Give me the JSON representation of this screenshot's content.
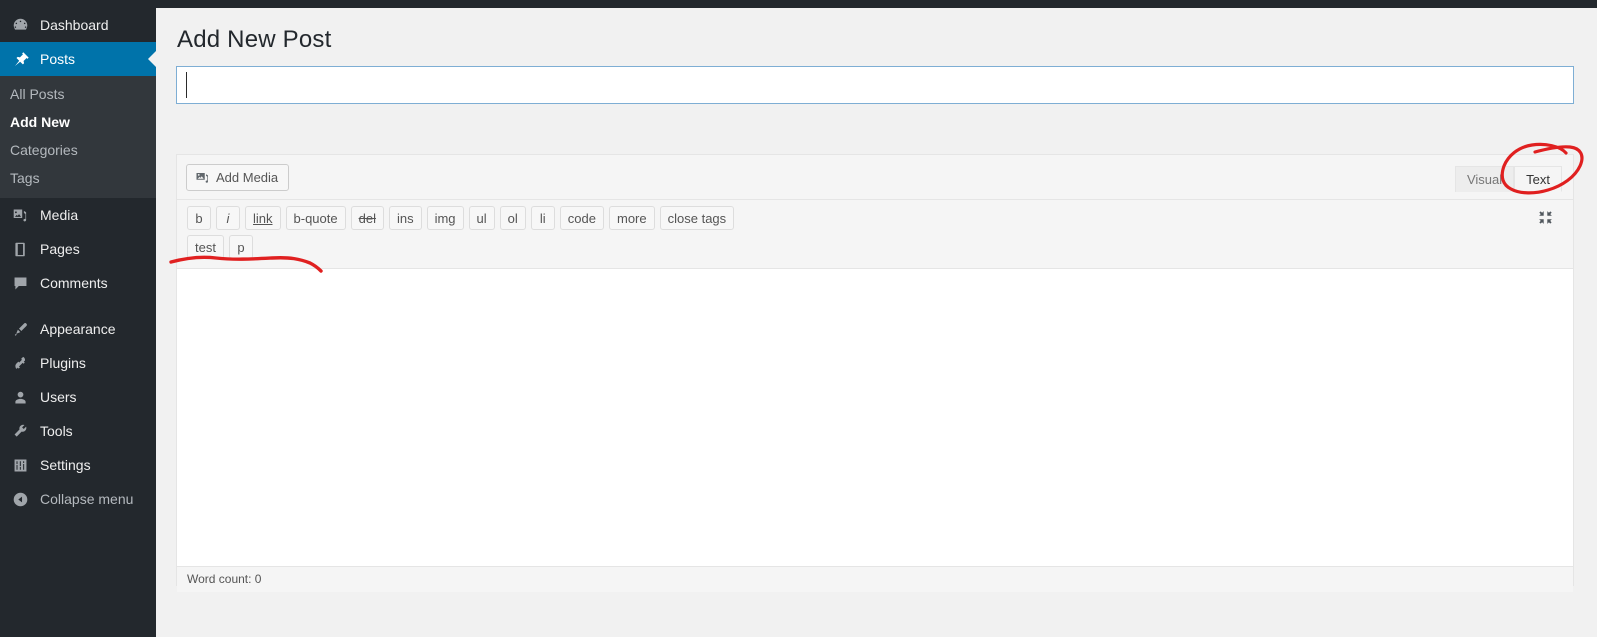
{
  "sidebar": {
    "items": [
      {
        "label": "Dashboard",
        "icon": "dashboard-icon",
        "current": false
      },
      {
        "label": "Posts",
        "icon": "pin-icon",
        "current": true
      },
      {
        "label": "Media",
        "icon": "media-icon",
        "current": false
      },
      {
        "label": "Pages",
        "icon": "pages-icon",
        "current": false
      },
      {
        "label": "Comments",
        "icon": "comments-icon",
        "current": false
      },
      {
        "label": "Appearance",
        "icon": "brush-icon",
        "current": false
      },
      {
        "label": "Plugins",
        "icon": "plugin-icon",
        "current": false
      },
      {
        "label": "Users",
        "icon": "user-icon",
        "current": false
      },
      {
        "label": "Tools",
        "icon": "wrench-icon",
        "current": false
      },
      {
        "label": "Settings",
        "icon": "settings-icon",
        "current": false
      },
      {
        "label": "Collapse menu",
        "icon": "collapse-arrow-icon",
        "current": false
      }
    ],
    "posts_submenu": [
      {
        "label": "All Posts",
        "current": false
      },
      {
        "label": "Add New",
        "current": true
      },
      {
        "label": "Categories",
        "current": false
      },
      {
        "label": "Tags",
        "current": false
      }
    ]
  },
  "page": {
    "title": "Add New Post"
  },
  "title_field": {
    "value": "",
    "placeholder": ""
  },
  "editor": {
    "add_media_label": "Add Media",
    "add_media_icon": "add-media-icon",
    "fullscreen_icon": "fullscreen-icon",
    "tabs": [
      {
        "label": "Visual",
        "active": false
      },
      {
        "label": "Text",
        "active": true
      }
    ],
    "quicktags_row1": [
      {
        "label": "b",
        "style": "bold"
      },
      {
        "label": "i",
        "style": "italic"
      },
      {
        "label": "link",
        "style": "link"
      },
      {
        "label": "b-quote",
        "style": "normal"
      },
      {
        "label": "del",
        "style": "del"
      },
      {
        "label": "ins",
        "style": "normal"
      },
      {
        "label": "img",
        "style": "normal"
      },
      {
        "label": "ul",
        "style": "normal"
      },
      {
        "label": "ol",
        "style": "normal"
      },
      {
        "label": "li",
        "style": "normal"
      },
      {
        "label": "code",
        "style": "normal"
      },
      {
        "label": "more",
        "style": "normal"
      },
      {
        "label": "close tags",
        "style": "normal"
      }
    ],
    "quicktags_row2": [
      {
        "label": "test",
        "style": "normal"
      },
      {
        "label": "p",
        "style": "normal"
      }
    ],
    "content": "",
    "status": "Word count: 0"
  },
  "annotations": {
    "circle_target": "Text",
    "underline_target": "test / p custom quicktag buttons",
    "color": "#e02020"
  },
  "colors": {
    "admin_bar": "#23282d",
    "sidebar": "#23282d",
    "submenu": "#32373c",
    "accent_blue": "#0073aa",
    "page_bg": "#f1f1f1",
    "annotation_red": "#e02020"
  }
}
